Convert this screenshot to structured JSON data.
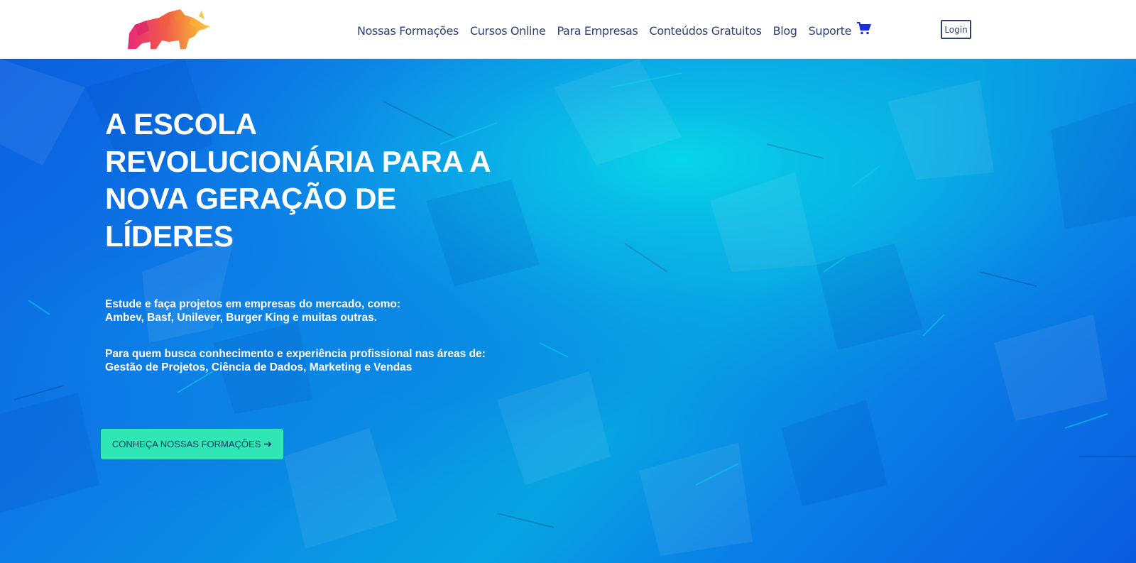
{
  "header": {
    "logo": "rhino-logo",
    "nav": [
      {
        "label": "Nossas Formações"
      },
      {
        "label": "Cursos Online"
      },
      {
        "label": "Para Empresas"
      },
      {
        "label": "Conteúdos Gratuitos"
      },
      {
        "label": "Blog"
      },
      {
        "label": "Suporte"
      }
    ],
    "cart_icon": "shopping-cart-icon",
    "login_label": "Login"
  },
  "hero": {
    "title_lines": [
      "A ESCOLA",
      "REVOLUCIONÁRIA PARA A",
      "NOVA GERAÇÃO DE",
      "LÍDERES"
    ],
    "paragraph1_lines": [
      "Estude e faça projetos em empresas do mercado, como:",
      "Ambev, Basf, Unilever, Burger King e muitas outras."
    ],
    "paragraph2_lines": [
      "Para quem busca conhecimento e experiência profissional nas áreas de:",
      "Gestão de Projetos, Ciência de Dados, Marketing e Vendas"
    ],
    "cta_label": "CONHEÇA NOSSAS FORMAÇÕES",
    "cta_icon": "arrow-right-icon"
  },
  "colors": {
    "nav_text": "#2f4074",
    "hero_blue": "#0b6ae2",
    "hero_cyan": "#07d6e6",
    "cta_bg": "#2fe6b4",
    "cta_text": "#10366f"
  }
}
